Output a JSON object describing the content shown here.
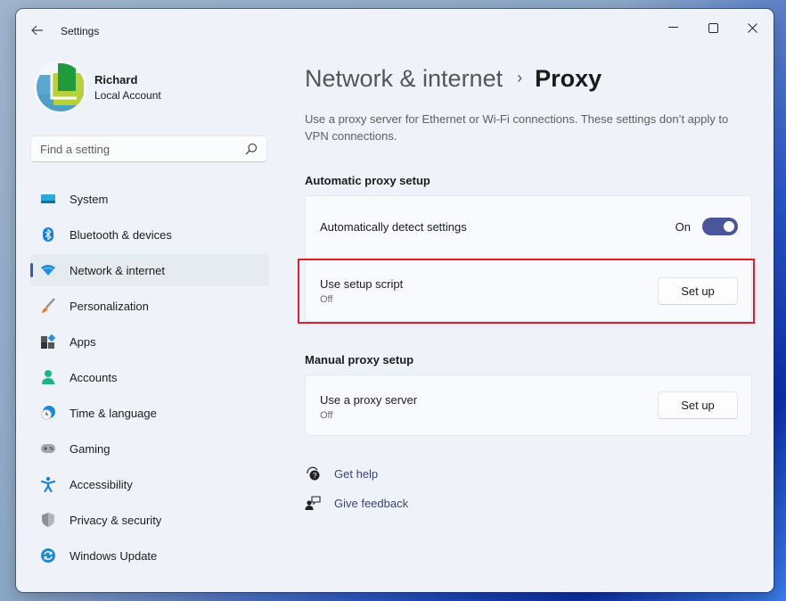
{
  "window": {
    "title": "Settings",
    "controls": {
      "minimize": "minimize",
      "maximize": "maximize",
      "close": "close"
    }
  },
  "profile": {
    "name": "Richard",
    "account_type": "Local Account"
  },
  "search": {
    "placeholder": "Find a setting",
    "value": ""
  },
  "sidebar": {
    "items": [
      {
        "label": "System",
        "icon": "system-icon",
        "active": false
      },
      {
        "label": "Bluetooth & devices",
        "icon": "bluetooth-icon",
        "active": false
      },
      {
        "label": "Network & internet",
        "icon": "wifi-icon",
        "active": true
      },
      {
        "label": "Personalization",
        "icon": "brush-icon",
        "active": false
      },
      {
        "label": "Apps",
        "icon": "apps-icon",
        "active": false
      },
      {
        "label": "Accounts",
        "icon": "person-icon",
        "active": false
      },
      {
        "label": "Time & language",
        "icon": "globe-clock-icon",
        "active": false
      },
      {
        "label": "Gaming",
        "icon": "gamepad-icon",
        "active": false
      },
      {
        "label": "Accessibility",
        "icon": "accessibility-icon",
        "active": false
      },
      {
        "label": "Privacy & security",
        "icon": "shield-icon",
        "active": false
      },
      {
        "label": "Windows Update",
        "icon": "update-icon",
        "active": false
      }
    ]
  },
  "main": {
    "breadcrumb": {
      "parent": "Network & internet",
      "separator": "›",
      "current": "Proxy"
    },
    "description": "Use a proxy server for Ethernet or Wi-Fi connections. These settings don’t apply to VPN connections.",
    "automatic": {
      "title": "Automatic proxy setup",
      "detect": {
        "label": "Automatically detect settings",
        "state": "On",
        "enabled": true
      },
      "script": {
        "label": "Use setup script",
        "status": "Off",
        "button": "Set up"
      }
    },
    "manual": {
      "title": "Manual proxy setup",
      "server": {
        "label": "Use a proxy server",
        "status": "Off",
        "button": "Set up"
      }
    },
    "links": {
      "help": "Get help",
      "feedback": "Give feedback"
    }
  },
  "colors": {
    "accent": "#4a5699",
    "highlight": "#d6212e",
    "window_bg": "#eff3f9"
  }
}
